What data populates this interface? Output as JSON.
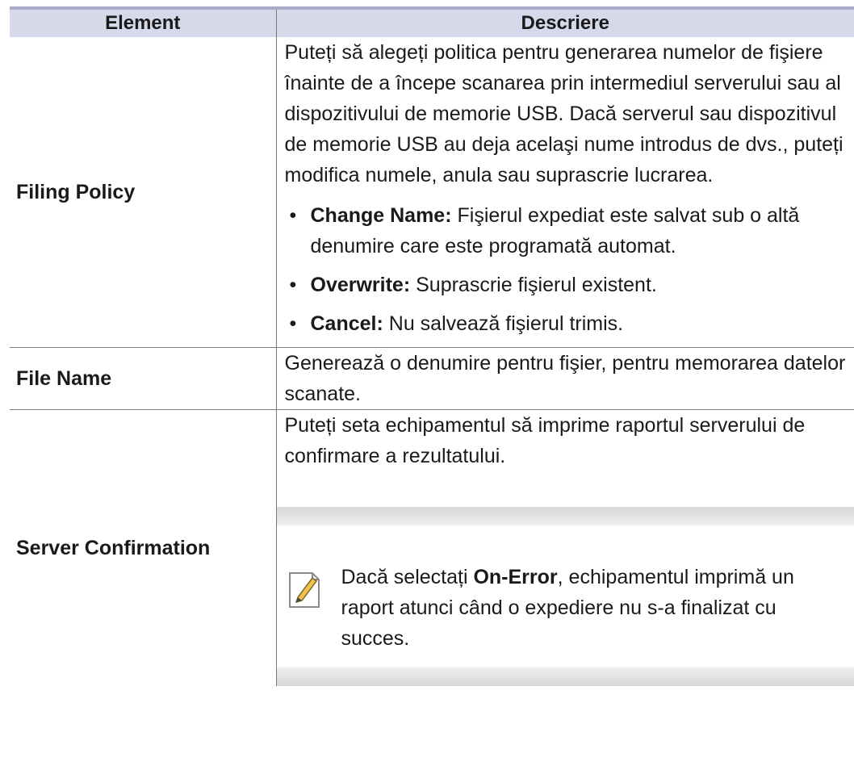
{
  "header": {
    "col1": "Element",
    "col2": "Descriere"
  },
  "rows": {
    "filing": {
      "label": "Filing Policy",
      "description": "Puteți să alegeți politica pentru generarea numelor de fişiere înainte de a începe scanarea prin intermediul serverului sau al dispozitivului de memorie USB. Dacă serverul sau dispozitivul de memorie USB au deja acelaşi nume introdus de dvs., puteți modifica numele, anula sau suprascrie lucrarea.",
      "options": [
        {
          "name": "Change Name:",
          "text": " Fişierul expediat este salvat sub o altă denumire care este programată automat."
        },
        {
          "name": "Overwrite:",
          "text": " Suprascrie fişierul existent."
        },
        {
          "name": "Cancel:",
          "text": " Nu salvează fişierul trimis."
        }
      ]
    },
    "filename": {
      "label": "File Name",
      "description": "Generează o denumire pentru fişier, pentru memorarea datelor scanate."
    },
    "server": {
      "label": "Server Confirmation",
      "description": "Puteți seta echipamentul să imprime raportul serverului de confirmare a rezultatului.",
      "note": {
        "before": "Dacă selectați ",
        "bold": "On-Error",
        "after": ", echipamentul imprimă un raport atunci când o expediere nu s-a finalizat cu succes."
      }
    }
  },
  "colors": {
    "header_bg": "#d6d9ea",
    "header_rule": "#a8acc9",
    "note_band": "#d8d8d8"
  },
  "icons": {
    "note": "note-pencil-icon"
  }
}
